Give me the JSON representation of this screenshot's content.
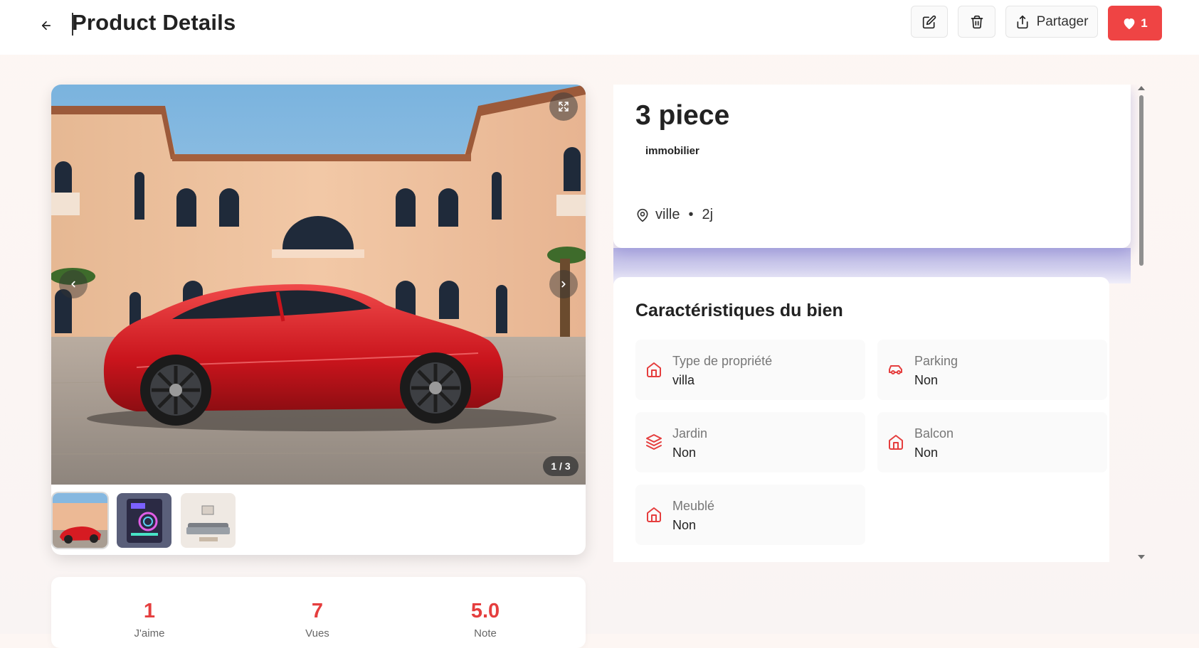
{
  "header": {
    "title": "Product Details",
    "share_label": "Partager",
    "like_count": "1"
  },
  "gallery": {
    "counter": "1 / 3"
  },
  "stats": [
    {
      "value": "1",
      "label": "J'aime"
    },
    {
      "value": "7",
      "label": "Vues"
    },
    {
      "value": "5.0",
      "label": "Note"
    }
  ],
  "product": {
    "title": "3 piece",
    "category": "immobilier",
    "location": "ville",
    "time_ago": "2j"
  },
  "features": {
    "title": "Caractéristiques du bien",
    "items": [
      {
        "key": "Type de propriété",
        "value": "villa",
        "icon": "home-icon"
      },
      {
        "key": "Parking",
        "value": "Non",
        "icon": "car-icon"
      },
      {
        "key": "Jardin",
        "value": "Non",
        "icon": "layers-icon"
      },
      {
        "key": "Balcon",
        "value": "Non",
        "icon": "home-icon"
      },
      {
        "key": "Meublé",
        "value": "Non",
        "icon": "home-icon"
      }
    ]
  },
  "colors": {
    "accent": "#ef4444",
    "stat_number": "#e53e3e"
  }
}
